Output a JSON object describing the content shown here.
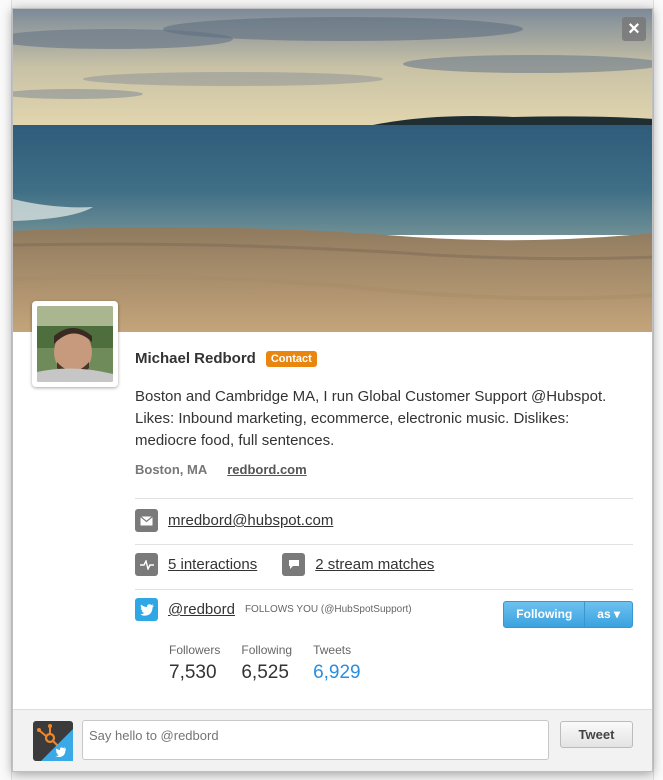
{
  "profile": {
    "name": "Michael Redbord",
    "badge": "Contact",
    "bio": "Boston and Cambridge MA, I run Global Customer Support @Hubspot. Likes: Inbound marketing, ecommerce, electronic music. Dislikes: mediocre food, full sentences.",
    "location": "Boston, MA",
    "website": "redbord.com"
  },
  "contact": {
    "email": "mredbord@hubspot.com",
    "interactions": "5 interactions",
    "stream_matches": "2 stream matches"
  },
  "twitter": {
    "handle": "@redbord",
    "follows_you": "FOLLOWS YOU (@HubSpotSupport)",
    "following_button": "Following",
    "as_button": "as ▾",
    "stats": [
      {
        "label": "Followers",
        "value": "7,530"
      },
      {
        "label": "Following",
        "value": "6,525"
      },
      {
        "label": "Tweets",
        "value": "6,929"
      }
    ]
  },
  "composer": {
    "placeholder": "Say hello to @redbord",
    "tweet_button": "Tweet"
  },
  "icons": {
    "close": "close-icon",
    "email": "envelope-icon",
    "interactions": "activity-icon",
    "stream": "chat-bubble-icon",
    "twitter": "twitter-bird-icon"
  },
  "colors": {
    "badge": "#e8860f",
    "twitter": "#2fa7e5",
    "tweets_count": "#2a8ee0"
  }
}
